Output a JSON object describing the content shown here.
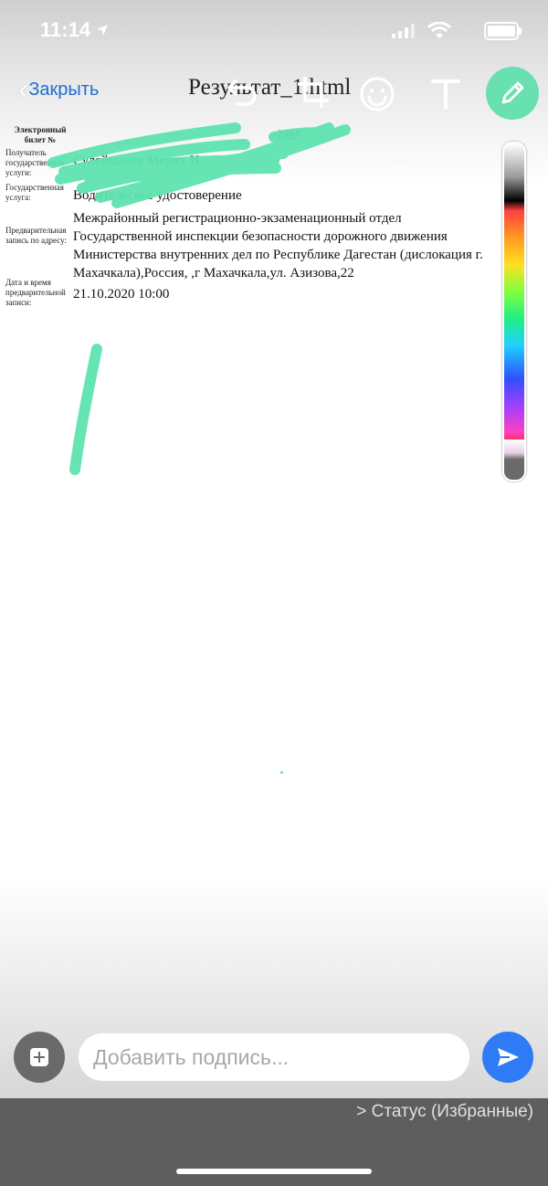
{
  "status_bar": {
    "time": "11:14"
  },
  "header": {
    "close_label": "Закрыть",
    "title": "Результат_1.html",
    "tools": [
      "undo-icon",
      "crop-icon",
      "emoji-icon",
      "text-icon",
      "pen-icon"
    ]
  },
  "document": {
    "ticket_label": "Электронный билет №",
    "ticket_number": "2404",
    "recipient_label": "Получатель государственной услуги:",
    "recipient_value": "Сулейманов Мерих И.",
    "service_label": "Государственная услуга:",
    "service_value": "Водительское удостоверение",
    "address_label": "Предварительная запись по адресу:",
    "address_value": "Межрайонный регистрационно-экзаменационный отдел Государственной инспекции безопасности дорожного движения Министерства внутренних дел по Республике Дагестан (дислокация г. Махачкала),Россия, ,г Махачкала,ул. Азизова,22",
    "datetime_label": "Дата и время предварительной записи:",
    "datetime_value": "21.10.2020 10:00"
  },
  "drawing": {
    "stroke_color": "#5fe3b0"
  },
  "footer": {
    "caption_placeholder": "Добавить подпись...",
    "status_link": "> Статус (Избранные)"
  },
  "colors": {
    "accent": "#2f7bf5",
    "pen": "#69e0b0",
    "link": "#1c6fd1"
  }
}
